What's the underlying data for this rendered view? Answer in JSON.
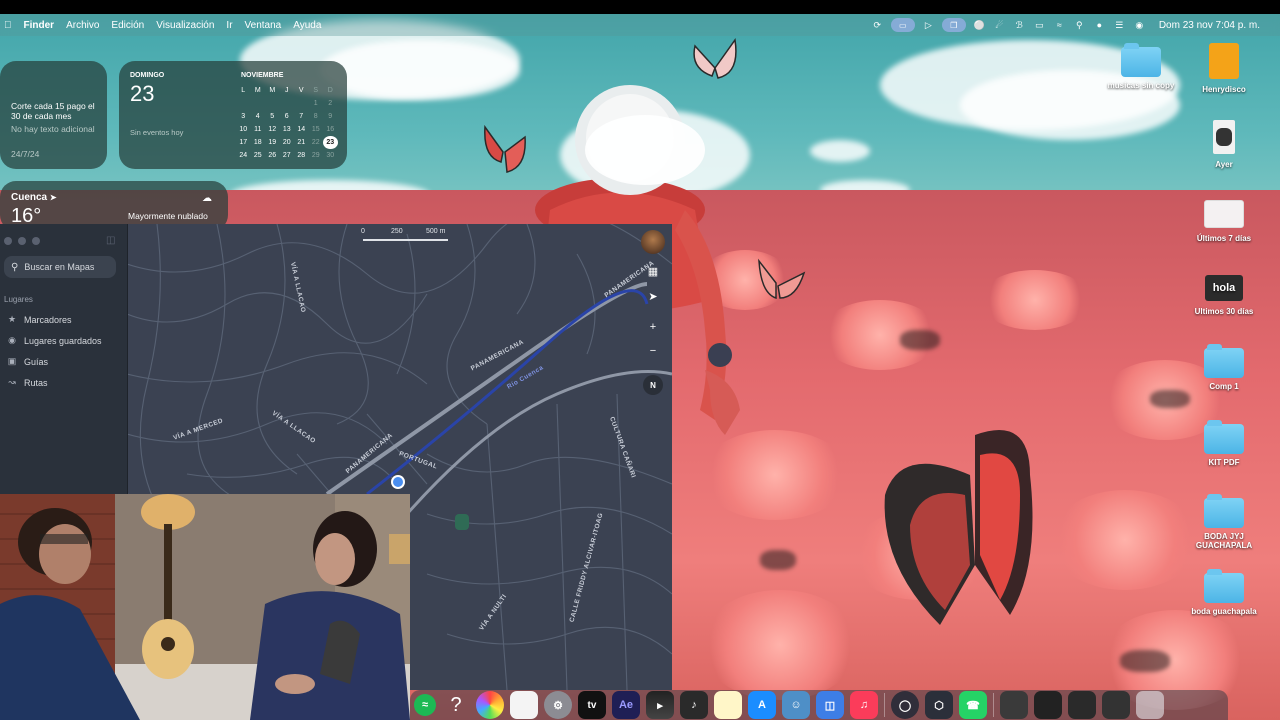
{
  "menubar": {
    "apple_icon": "apple-logo-icon",
    "items": [
      "Finder",
      "Archivo",
      "Edición",
      "Visualización",
      "Ir",
      "Ventana",
      "Ayuda"
    ],
    "datetime": "Dom 23 nov  7:04 p. m."
  },
  "widgets": {
    "note": {
      "title": "Corte cada 15 pago el 30 de cada mes",
      "subtitle": "No hay texto adicional",
      "date": "24/7/24"
    },
    "calendar": {
      "weekday": "DOMINGO",
      "day": "23",
      "no_events": "Sin eventos hoy",
      "month": "NOVIEMBRE",
      "weekday_headers": [
        "L",
        "M",
        "M",
        "J",
        "V",
        "S",
        "D"
      ],
      "weeks": [
        [
          "",
          "",
          "",
          "",
          "",
          "1",
          "2"
        ],
        [
          "3",
          "4",
          "5",
          "6",
          "7",
          "8",
          "9"
        ],
        [
          "10",
          "11",
          "12",
          "13",
          "14",
          "15",
          "16"
        ],
        [
          "17",
          "18",
          "19",
          "20",
          "21",
          "22",
          "23"
        ],
        [
          "24",
          "25",
          "26",
          "27",
          "28",
          "29",
          "30"
        ]
      ],
      "today": "23"
    },
    "weather": {
      "city": "Cuenca",
      "temp": "16°",
      "condition": "Mayormente nublado"
    }
  },
  "maps": {
    "search_placeholder": "Buscar en Mapas",
    "section": "Lugares",
    "items": [
      {
        "label": "Marcadores",
        "icon": "bookmark-icon"
      },
      {
        "label": "Lugares guardados",
        "icon": "pin-icon"
      },
      {
        "label": "Guías",
        "icon": "guides-icon"
      },
      {
        "label": "Rutas",
        "icon": "route-icon"
      }
    ],
    "scale": [
      "0",
      "250",
      "500 m"
    ],
    "compass": "N",
    "road_labels": [
      "PANAMERICANA",
      "PANAMERICANA",
      "PANAMERICANA",
      "VÍA A LLACAO",
      "VÍA A LLACAO",
      "VÍA A MERCED",
      "PORTUGAL",
      "VÍA A NULTI",
      "CALLE FRIDDY ALCIVAR-ITOAG",
      "Río Cuenca",
      "CULTURA CAÑARI"
    ]
  },
  "desktop_icons": [
    {
      "label": "musicas sin copy",
      "kind": "folder"
    },
    {
      "label": "Henrydisco",
      "kind": "file"
    },
    {
      "label": "Ayer",
      "kind": "image"
    },
    {
      "label": "Últimos 7 días",
      "kind": "image"
    },
    {
      "label": "Ultimos 30 días",
      "kind": "image"
    },
    {
      "label": "Comp 1",
      "kind": "folder"
    },
    {
      "label": "KIT PDF",
      "kind": "folder"
    },
    {
      "label": "BODA JYJ GUACHAPALA",
      "kind": "folder"
    },
    {
      "label": "boda guachapala",
      "kind": "folder"
    }
  ],
  "desktop_thumb_text": "hola",
  "dock": {
    "apps": [
      "spotify-icon",
      "help-icon",
      "photos-icon",
      "reminders-icon",
      "settings-icon",
      "apple-tv-icon",
      "after-effects-icon",
      "final-cut-icon",
      "logic-icon",
      "notes-icon",
      "app-store-icon",
      "finder-icon",
      "preview-icon",
      "music-icon",
      "obs-icon",
      "unity-icon",
      "whatsapp-icon",
      "window1-icon",
      "window2-icon",
      "window3-icon",
      "window4-icon",
      "trash-icon"
    ],
    "labels": {
      "tv": "tv",
      "ae": "Ae",
      "help": "?"
    }
  },
  "colors": {
    "accent_blue": "#4a8ef0",
    "maps_bg": "#3a4150",
    "wallpaper_field": "#e36a6e",
    "wallpaper_sky": "#5fb9bb"
  }
}
